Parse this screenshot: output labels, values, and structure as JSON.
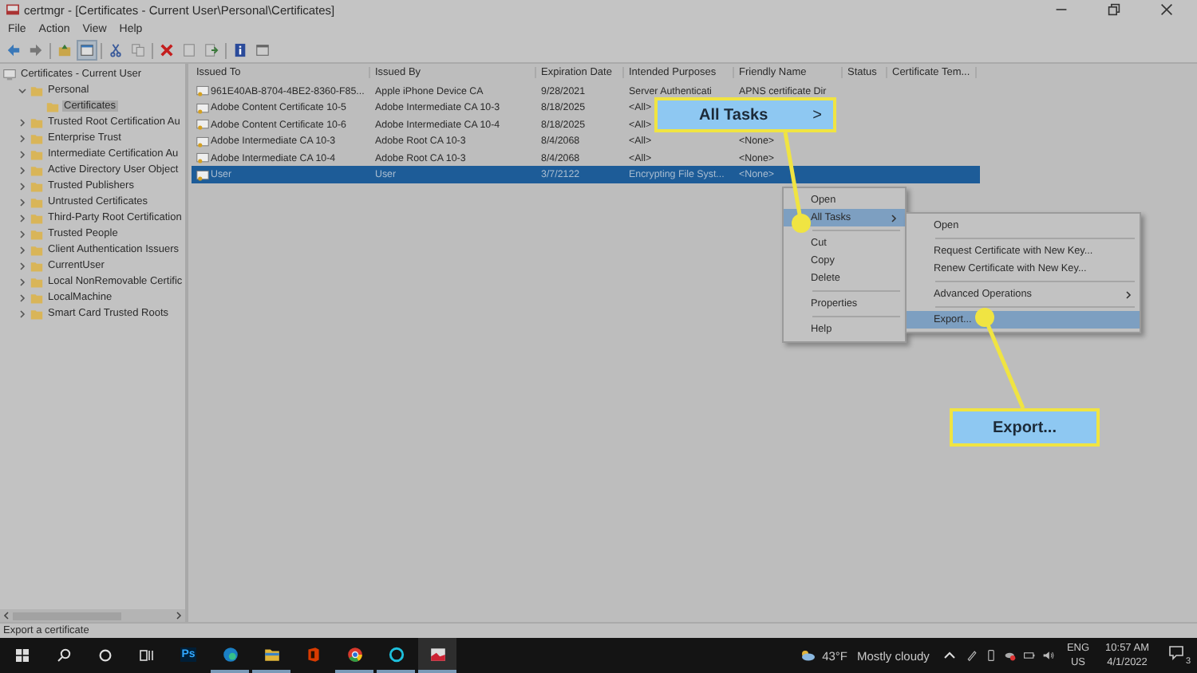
{
  "window": {
    "title": "certmgr - [Certificates - Current User\\Personal\\Certificates]"
  },
  "menu": [
    "File",
    "Action",
    "View",
    "Help"
  ],
  "tree": [
    {
      "label": "Certificates - Current User",
      "selected": false,
      "children": [
        {
          "label": "Personal",
          "expanded": true,
          "selected": false,
          "children": [
            {
              "label": "Certificates",
              "selected": true
            }
          ]
        },
        {
          "label": "Trusted Root Certification Au",
          "expanded": false,
          "selected": false
        },
        {
          "label": "Enterprise Trust",
          "expanded": false,
          "selected": false
        },
        {
          "label": "Intermediate Certification Au",
          "expanded": false,
          "selected": false
        },
        {
          "label": "Active Directory User Object",
          "expanded": false,
          "selected": false
        },
        {
          "label": "Trusted Publishers",
          "expanded": false,
          "selected": false
        },
        {
          "label": "Untrusted Certificates",
          "expanded": false,
          "selected": false
        },
        {
          "label": "Third-Party Root Certification",
          "expanded": false,
          "selected": false
        },
        {
          "label": "Trusted People",
          "expanded": false,
          "selected": false
        },
        {
          "label": "Client Authentication Issuers",
          "expanded": false,
          "selected": false
        },
        {
          "label": "CurrentUser",
          "expanded": false,
          "selected": false
        },
        {
          "label": "Local NonRemovable Certific",
          "expanded": false,
          "selected": false
        },
        {
          "label": "LocalMachine",
          "expanded": false,
          "selected": false
        },
        {
          "label": "Smart Card Trusted Roots",
          "expanded": false,
          "selected": false
        }
      ]
    }
  ],
  "table": {
    "columns": [
      "Issued To",
      "Issued By",
      "Expiration Date",
      "Intended Purposes",
      "Friendly Name",
      "Status",
      "Certificate Tem..."
    ],
    "rows": [
      {
        "cells": [
          "961E40AB-8704-4BE2-8360-F85...",
          "Apple iPhone Device CA",
          "9/28/2021",
          "Server Authenticati",
          "APNS certificate Dir",
          "",
          ""
        ],
        "selected": false
      },
      {
        "cells": [
          "Adobe Content Certificate 10-5",
          "Adobe Intermediate CA 10-3",
          "8/18/2025",
          "<All>",
          "",
          "",
          ""
        ],
        "selected": false
      },
      {
        "cells": [
          "Adobe Content Certificate 10-6",
          "Adobe Intermediate CA 10-4",
          "8/18/2025",
          "<All>",
          "",
          "",
          ""
        ],
        "selected": false
      },
      {
        "cells": [
          "Adobe Intermediate CA 10-3",
          "Adobe Root CA 10-3",
          "8/4/2068",
          "<All>",
          "<None>",
          "",
          ""
        ],
        "selected": false
      },
      {
        "cells": [
          "Adobe Intermediate CA 10-4",
          "Adobe Root CA 10-3",
          "8/4/2068",
          "<All>",
          "<None>",
          "",
          ""
        ],
        "selected": false
      },
      {
        "cells": [
          "User",
          "User",
          "3/7/2122",
          "Encrypting File Syst...",
          "<None>",
          "",
          ""
        ],
        "selected": true
      }
    ]
  },
  "context_menu": [
    {
      "kind": "item",
      "label": "Open",
      "highlighted": false,
      "submenu": false
    },
    {
      "kind": "item",
      "label": "All Tasks",
      "highlighted": true,
      "submenu": true
    },
    {
      "kind": "separator"
    },
    {
      "kind": "item",
      "label": "Cut",
      "highlighted": false,
      "submenu": false
    },
    {
      "kind": "item",
      "label": "Copy",
      "highlighted": false,
      "submenu": false
    },
    {
      "kind": "item",
      "label": "Delete",
      "highlighted": false,
      "submenu": false
    },
    {
      "kind": "separator"
    },
    {
      "kind": "item",
      "label": "Properties",
      "highlighted": false,
      "submenu": false
    },
    {
      "kind": "separator"
    },
    {
      "kind": "item",
      "label": "Help",
      "highlighted": false,
      "submenu": false
    }
  ],
  "submenu": [
    {
      "kind": "item",
      "label": "Open",
      "highlighted": false,
      "submenu": false
    },
    {
      "kind": "separator"
    },
    {
      "kind": "item",
      "label": "Request Certificate with New Key...",
      "highlighted": false,
      "submenu": false
    },
    {
      "kind": "item",
      "label": "Renew Certificate with New Key...",
      "highlighted": false,
      "submenu": false
    },
    {
      "kind": "separator"
    },
    {
      "kind": "item",
      "label": "Advanced Operations",
      "highlighted": false,
      "submenu": true
    },
    {
      "kind": "separator"
    },
    {
      "kind": "item",
      "label": "Export...",
      "highlighted": true,
      "submenu": false
    }
  ],
  "callouts": [
    {
      "label": "All Tasks",
      "arrow": ">"
    },
    {
      "label": "Export..."
    }
  ],
  "status_bar": "Export a certificate",
  "taskbar": {
    "apps": [
      {
        "kind": "photoshop",
        "label": "Ps",
        "running": false,
        "active": false
      },
      {
        "kind": "browser",
        "running": true,
        "active": false
      },
      {
        "kind": "folder",
        "running": true,
        "active": false
      },
      {
        "kind": "office",
        "running": false,
        "active": false
      },
      {
        "kind": "chrome",
        "running": true,
        "active": false
      },
      {
        "kind": "ring",
        "running": true,
        "active": false
      },
      {
        "kind": "certmgr",
        "running": true,
        "active": true
      }
    ],
    "weather": {
      "temp": "43°F",
      "condition": "Mostly cloudy"
    },
    "language": [
      "ENG",
      "US"
    ],
    "time": "10:57 AM",
    "date": "4/1/2022",
    "notifications": "3"
  }
}
